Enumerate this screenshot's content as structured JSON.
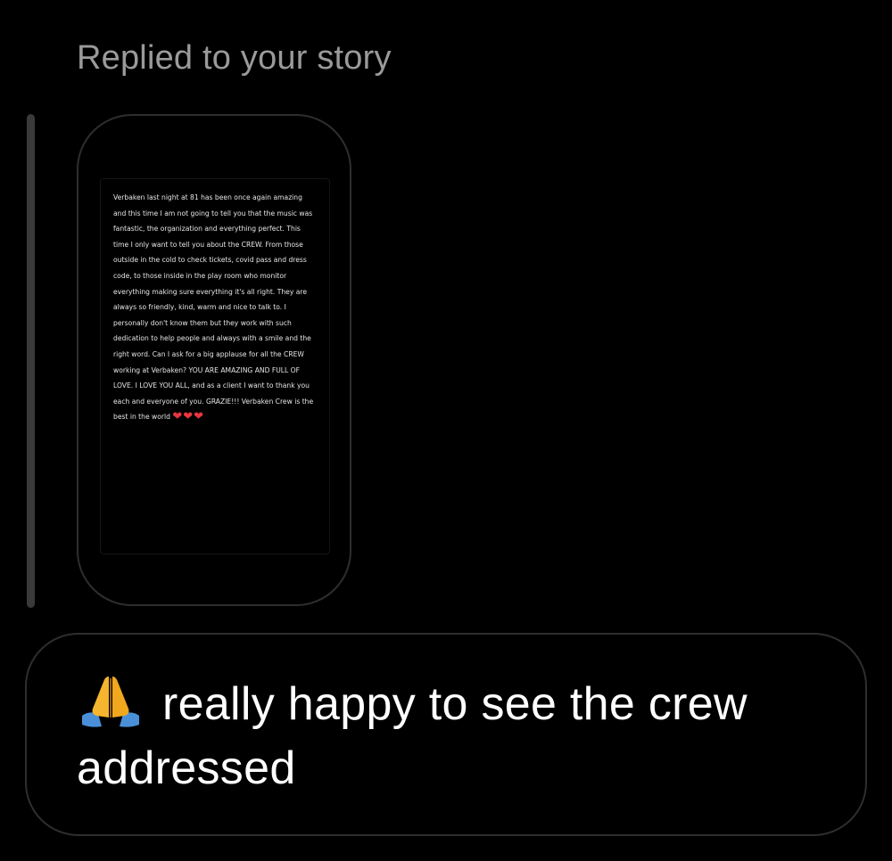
{
  "reply": {
    "header": "Replied to your story"
  },
  "story": {
    "text": "Verbaken last night at 81 has been once again amazing and this time I am not going to tell you that the music was fantastic, the organization and everything perfect. This time I only want to tell you about the CREW. From those outside in the cold to check tickets, covid pass and dress code, to those inside in the play room who monitor everything making sure everything it's all right. They are always so friendly, kind, warm and nice to talk to. I personally don't know them but they work with such dedication to help people and always with a smile and the right word. Can I ask for a big applause for all the CREW working at Verbaken? YOU ARE AMAZING AND FULL OF LOVE. I LOVE YOU ALL, and as a client I want to thank you each and everyone of you. GRAZIE!!! Verbaken Crew is the best in the world ",
    "hearts": "❤❤❤"
  },
  "message": {
    "icon": "folded-hands-icon",
    "text": "really happy to see the crew addressed"
  },
  "colors": {
    "background": "#000000",
    "header_text": "#9a9a9a",
    "border": "#2e2e2e",
    "heart": "#e8363f",
    "emoji_hands": "#f5b52e",
    "emoji_sleeve": "#4a90d9"
  }
}
